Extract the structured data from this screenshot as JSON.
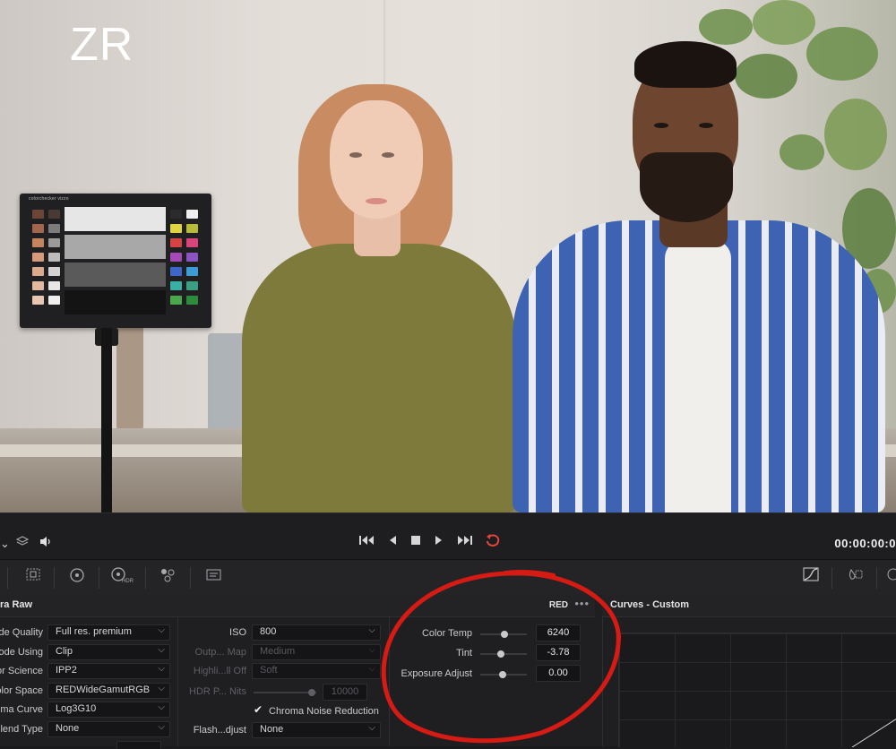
{
  "viewer": {
    "overlay_label": "ZR",
    "color_checker_brand": "colorchecker vizzo"
  },
  "transport": {
    "timecode": "00:00:00:0"
  },
  "camera_raw": {
    "panel_title": "ra Raw",
    "badge": "RED",
    "more": "•••",
    "left_rows": [
      {
        "label": "de Quality",
        "value": "Full res. premium"
      },
      {
        "label": "ode Using",
        "value": "Clip"
      },
      {
        "label": "or Science",
        "value": "IPP2"
      },
      {
        "label": "olor Space",
        "value": "REDWideGamutRGB"
      },
      {
        "label": "ma Curve",
        "value": "Log3G10"
      },
      {
        "label": "lend Type",
        "value": "None"
      }
    ],
    "mid_rows": [
      {
        "label": "ISO",
        "value": "800"
      },
      {
        "label": "Outp... Map",
        "value": "Medium"
      },
      {
        "label": "Highli...ll Off",
        "value": "Soft"
      }
    ],
    "hdr_label": "HDR P... Nits",
    "hdr_value": "10000",
    "chroma_noise_label": "Chroma Noise Reduction",
    "chroma_noise_checked": true,
    "flash_label": "Flash...djust",
    "flash_value": "None",
    "color_temp_label": "Color Temp",
    "color_temp_value": "6240",
    "tint_label": "Tint",
    "tint_value": "-3.78",
    "exposure_label": "Exposure Adjust",
    "exposure_value": "0.00"
  },
  "curves": {
    "title": "Curves - Custom"
  },
  "colors": {
    "annotation": "#d61a14",
    "loop_active": "#e0463c"
  }
}
